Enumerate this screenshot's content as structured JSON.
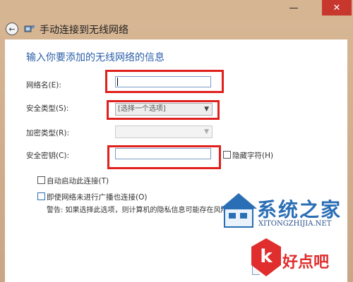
{
  "window": {
    "minimize_icon": "—",
    "close_icon": "✕",
    "close_color": "#c7372e"
  },
  "header": {
    "back_icon": "←",
    "title": "手动连接到无线网络"
  },
  "form": {
    "heading": "输入你要添加的无线网络的信息",
    "network_name_label": "网络名(E):",
    "network_name_value": "",
    "security_type_label": "安全类型(S):",
    "security_type_value": "[选择一个选项]",
    "encryption_type_label": "加密类型(R):",
    "encryption_type_value": "",
    "security_key_label": "安全密钥(C):",
    "security_key_value": "",
    "hide_chars_label": "隐藏字符(H)",
    "auto_connect_label": "自动启动此连接(T)",
    "connect_even_label": "即使网络未进行广播也连接(O)",
    "warning_text": "警告: 如果选择此选项，则计算机的隐私信息可能存在风险。"
  },
  "watermarks": {
    "site1_text": "系统之家",
    "site1_sub": "XITONGZHIJIA.NET",
    "site2_text": "好点吧"
  },
  "colors": {
    "highlight": "#e0201d",
    "heading": "#2b5fa8"
  }
}
